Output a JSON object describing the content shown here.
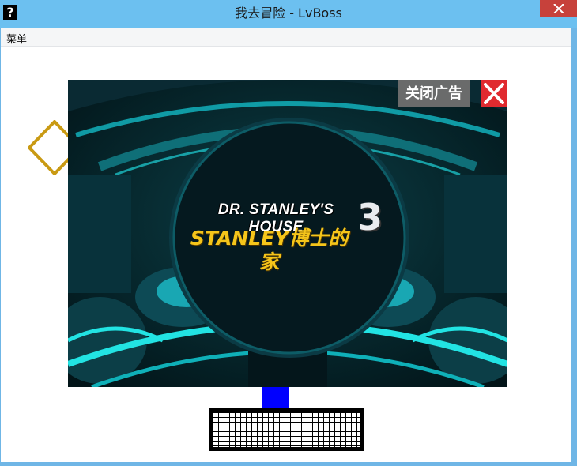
{
  "window": {
    "title": "我去冒险 - LvBoss",
    "app_icon": "?",
    "close_icon": "close-x-icon"
  },
  "menu": {
    "items": [
      "菜单"
    ]
  },
  "game": {
    "ad": {
      "close_label": "关闭广告",
      "close_icon": "close-x-icon",
      "title_en": "DR. STANLEY'S HOUSE",
      "title_zh": "STANLEY博士的家",
      "title_number": "3"
    },
    "colors": {
      "diamond": "#c99a13",
      "block": "#0000ff",
      "ad_close_bg": "#e02a2f",
      "ad_label_bg": "#6a6b6b",
      "title_yellow": "#f5c51a",
      "title_bar": "#6cc0f0"
    }
  }
}
